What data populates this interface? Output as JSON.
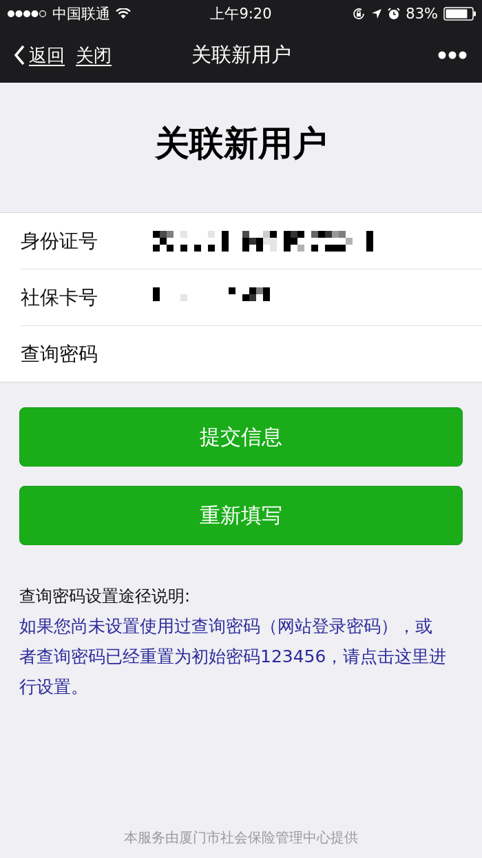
{
  "status_bar": {
    "carrier": "中国联通",
    "time": "上午9:20",
    "battery": "83%"
  },
  "nav_bar": {
    "back": "返回",
    "close": "关闭",
    "title": "关联新用户"
  },
  "heading": "关联新用户",
  "form": {
    "fields": [
      {
        "label": "身份证号",
        "kind": "redacted"
      },
      {
        "label": "社保卡号",
        "kind": "redacted"
      },
      {
        "label": "查询密码",
        "kind": "empty"
      }
    ]
  },
  "buttons": [
    "提交信息",
    "重新填写"
  ],
  "help": {
    "title": "查询密码设置途径说明:",
    "link": "如果您尚未设置使用过查询密码（网站登录密码），或者查询密码已经重置为初始密码123456，请点击这里进行设置。"
  },
  "footer": "本服务由厦门市社会保险管理中心提供"
}
